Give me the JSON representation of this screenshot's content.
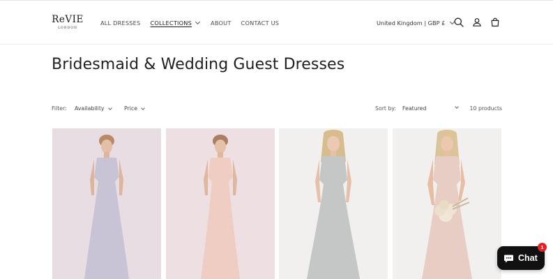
{
  "brand": {
    "logo_text": "ReVIE",
    "logo_subtext": "LONDON"
  },
  "nav": {
    "items": [
      {
        "label": "ALL DRESSES"
      },
      {
        "label": "COLLECTIONS"
      },
      {
        "label": "ABOUT"
      },
      {
        "label": "CONTACT US"
      }
    ]
  },
  "header": {
    "locale": "United Kingdom | GBP £"
  },
  "icons": {
    "search": "search-icon",
    "account": "account-icon",
    "cart": "cart-icon",
    "chat": "chat-bubble-icon"
  },
  "page": {
    "title": "Bridesmaid & Wedding Guest Dresses"
  },
  "filters": {
    "label": "Filter:",
    "availability": "Availability",
    "price": "Price",
    "sort_label": "Sort by:",
    "sort_value": "Featured",
    "count": "10 products"
  },
  "products": [
    {
      "dress_color": "#c9c3d6"
    },
    {
      "dress_color": "#efcdc2"
    },
    {
      "dress_color": "#c4c7c6"
    },
    {
      "dress_color": "#e8cdc4"
    }
  ],
  "chat": {
    "label": "Chat",
    "badge": "1"
  }
}
